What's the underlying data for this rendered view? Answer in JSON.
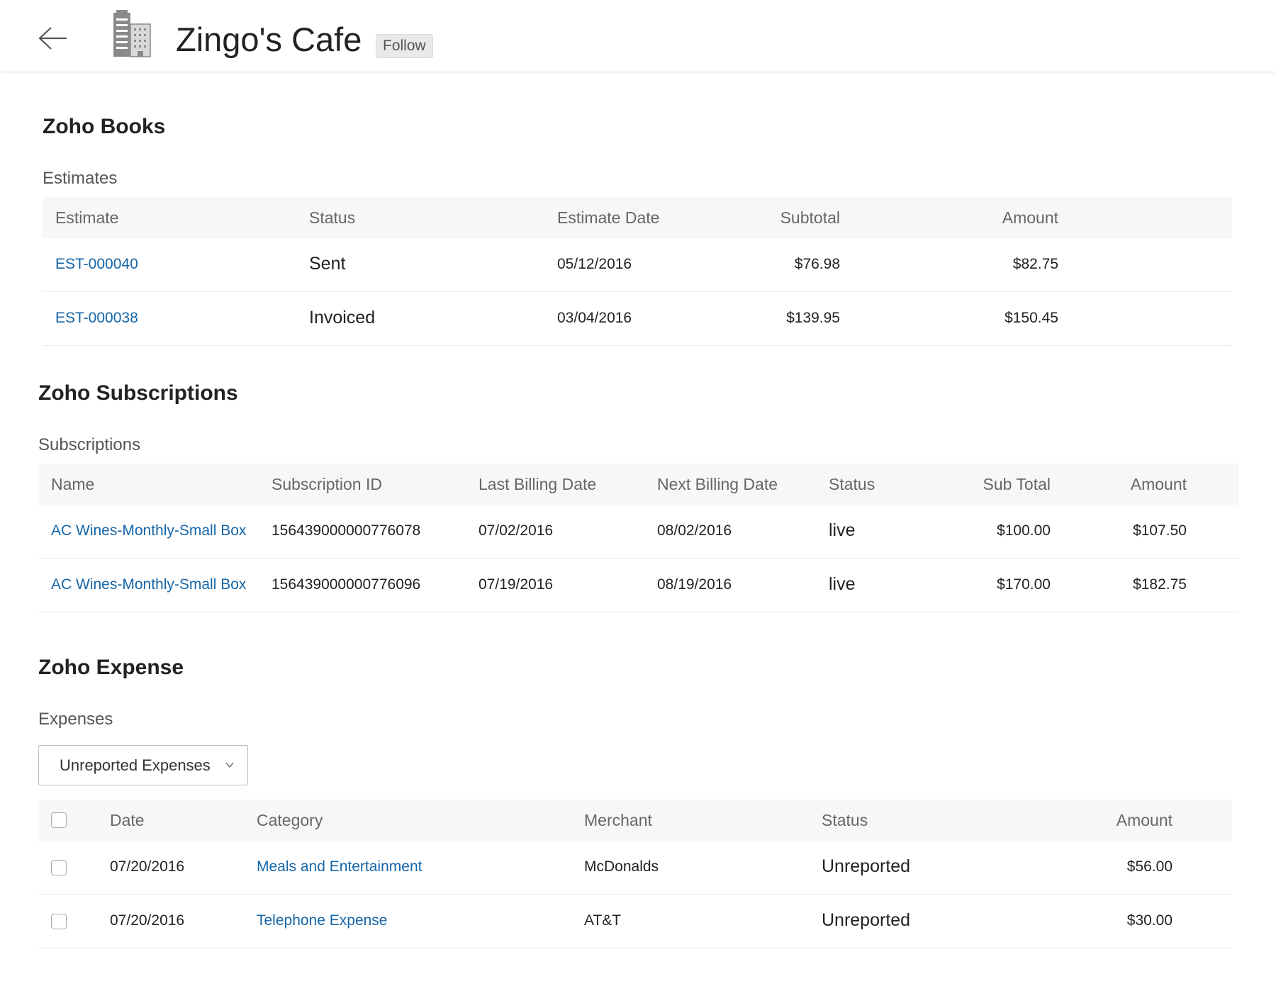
{
  "header": {
    "title": "Zingo's Cafe",
    "follow_label": "Follow"
  },
  "books": {
    "title": "Zoho Books",
    "subtitle": "Estimates",
    "columns": [
      "Estimate",
      "Status",
      "Estimate Date",
      "Subtotal",
      "Amount"
    ],
    "rows": [
      {
        "estimate": "EST-000040",
        "status": "Sent",
        "date": "05/12/2016",
        "subtotal": "$76.98",
        "amount": "$82.75"
      },
      {
        "estimate": "EST-000038",
        "status": "Invoiced",
        "date": "03/04/2016",
        "subtotal": "$139.95",
        "amount": "$150.45"
      }
    ]
  },
  "subscriptions": {
    "title": "Zoho Subscriptions",
    "subtitle": "Subscriptions",
    "columns": [
      "Name",
      "Subscription ID",
      "Last Billing Date",
      "Next Billing Date",
      "Status",
      "Sub Total",
      "Amount"
    ],
    "rows": [
      {
        "name": "AC Wines-Monthly-Small Box",
        "id": "156439000000776078",
        "last": "07/02/2016",
        "next": "08/02/2016",
        "status": "live",
        "subtotal": "$100.00",
        "amount": "$107.50"
      },
      {
        "name": "AC Wines-Monthly-Small Box",
        "id": "156439000000776096",
        "last": "07/19/2016",
        "next": "08/19/2016",
        "status": "live",
        "subtotal": "$170.00",
        "amount": "$182.75"
      }
    ]
  },
  "expense": {
    "title": "Zoho Expense",
    "subtitle": "Expenses",
    "filter_value": "Unreported Expenses",
    "columns": [
      "Date",
      "Category",
      "Merchant",
      "Status",
      "Amount"
    ],
    "rows": [
      {
        "date": "07/20/2016",
        "category": "Meals and Entertainment",
        "merchant": "McDonalds",
        "status": "Unreported",
        "amount": "$56.00"
      },
      {
        "date": "07/20/2016",
        "category": "Telephone Expense",
        "merchant": "AT&T",
        "status": "Unreported",
        "amount": "$30.00"
      }
    ]
  },
  "colors": {
    "link": "#1565a8",
    "header_bg": "#f7f7f7"
  }
}
